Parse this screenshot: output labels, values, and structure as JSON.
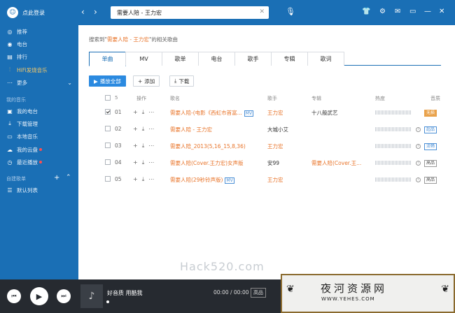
{
  "sidebar": {
    "login_label": "点此登录",
    "items": [
      {
        "label": "推荐",
        "icon": "compass-icon"
      },
      {
        "label": "电台",
        "icon": "radio-icon"
      },
      {
        "label": "排行",
        "icon": "chart-icon"
      },
      {
        "label": "HiFi发烧音乐",
        "icon": "waveform-icon"
      },
      {
        "label": "更多",
        "icon": "more-icon"
      }
    ],
    "my_music_title": "我的音乐",
    "my_items": [
      {
        "label": "我的电台",
        "icon": "radio-icon"
      },
      {
        "label": "下载管理",
        "icon": "download-icon"
      },
      {
        "label": "本地音乐",
        "icon": "monitor-icon"
      },
      {
        "label": "我的云盘",
        "icon": "cloud-icon"
      },
      {
        "label": "最近播放",
        "icon": "clock-icon"
      }
    ],
    "playlist_title": "自建歌单",
    "playlist_items": [
      {
        "label": "默认列表",
        "icon": "list-icon"
      }
    ]
  },
  "topbar": {
    "search_value": "需要人陪 - 王力宏"
  },
  "main": {
    "hint_prefix": "搜索到\"",
    "hint_keyword": "需要人陪 - 王力宏",
    "hint_suffix": "\"的相关歌曲",
    "tabs": [
      "单曲",
      "MV",
      "歌单",
      "电台",
      "歌手",
      "专辑",
      "歌词"
    ],
    "buttons": {
      "play_all": "播放全部",
      "add": "添加",
      "download": "下载"
    },
    "headers": {
      "count": "5",
      "ops": "操作",
      "song": "歌名",
      "singer": "歌手",
      "album": "专辑",
      "heat": "热度",
      "quality": "音质"
    },
    "rows": [
      {
        "num": "01",
        "checked": true,
        "song": "需要人陪-(电影《西虹市首富...",
        "mv": "MV",
        "singer": "王力宏",
        "album": "十八般武艺",
        "quality": "无损",
        "qtype": "gold"
      },
      {
        "num": "02",
        "checked": false,
        "song": "需要人陪 - 王力宏",
        "mv": "",
        "singer": "大城小艾",
        "album": "",
        "quality": "超品",
        "qtype": "blue"
      },
      {
        "num": "03",
        "checked": false,
        "song": "需要人陪_2013(5,16_15,8,36)",
        "mv": "",
        "singer": "王力宏",
        "album": "",
        "quality": "流畅",
        "qtype": "blue"
      },
      {
        "num": "04",
        "checked": false,
        "song": "需要人陪(Cover.王力宏)女声版",
        "mv": "",
        "singer": "安99",
        "album": "需要人陪(Cover.王...",
        "quality": "高品",
        "qtype": "plain"
      },
      {
        "num": "05",
        "checked": false,
        "song": "需要人陪(29秒铃声版)",
        "mv": "MV",
        "singer": "王力宏",
        "album": "",
        "quality": "高品",
        "qtype": "plain"
      }
    ],
    "watermark": "Hack520.com"
  },
  "player": {
    "title": "好音质 用酷我",
    "time": "00:00 / 00:00",
    "quality": "高品"
  },
  "logo": {
    "title": "夜河资源网",
    "url": "WWW.YEHES.COM"
  }
}
